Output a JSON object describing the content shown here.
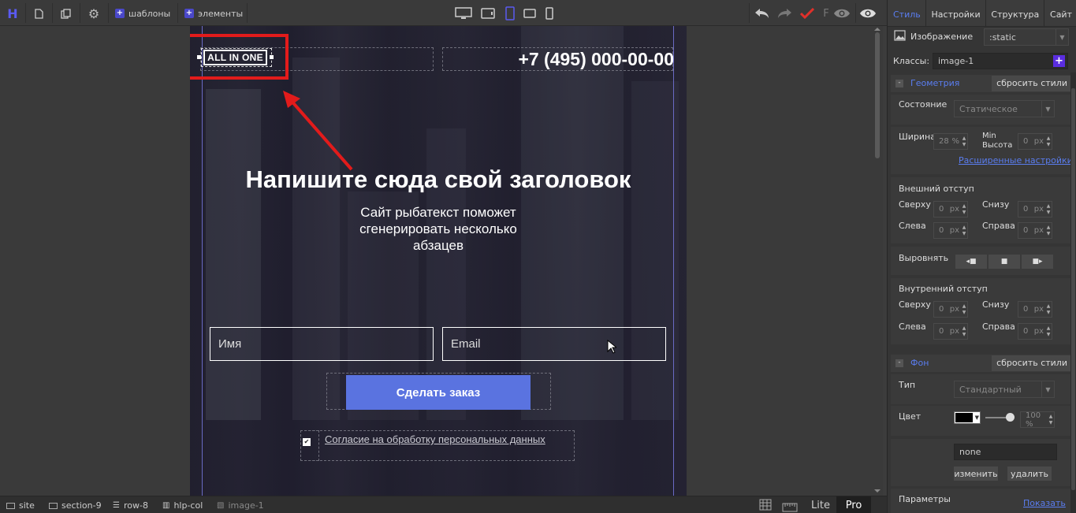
{
  "toolbar": {
    "logo": "H",
    "templates_label": "шаблоны",
    "elements_label": "элементы",
    "preview_letter": "F"
  },
  "site": {
    "logo_text": "ALL IN ONE",
    "phone": "+7 (495) 000-00-00",
    "headline": "Напишите сюда свой заголовок",
    "subtext": "Сайт рыбатекст поможет сгенерировать несколько абзацев",
    "name_placeholder": "Имя",
    "email_placeholder": "Email",
    "order_button": "Сделать заказ",
    "consent_text": "Согласие на обработку персональных данных",
    "consent_checked": true
  },
  "colors": {
    "accent": "#5a7df0",
    "annotation": "#e21b1b",
    "order_button": "#5a73e0",
    "save_check": "#e0302a"
  },
  "panel": {
    "tabs": [
      "Стиль",
      "Настройки",
      "Структура",
      "Сайт"
    ],
    "active_tab": "Стиль",
    "element_label": "Изображение",
    "position_value": ":static",
    "classes_label": "Классы:",
    "class_value": "image-1",
    "geometry": {
      "title": "Геометрия",
      "reset": "сбросить стили",
      "state_label": "Состояние",
      "state_value": "Статическое",
      "width_label": "Ширина",
      "width_value": "28",
      "width_unit": "%",
      "min_height_label": "Min Высота",
      "min_height_value": "0",
      "min_height_unit": "px",
      "advanced_link": "Расширенные настройки"
    },
    "margin": {
      "title": "Внешний отступ",
      "top_label": "Сверху",
      "top": "0",
      "bottom_label": "Снизу",
      "bottom": "0",
      "left_label": "Слева",
      "left": "0",
      "right_label": "Справа",
      "right": "0",
      "unit": "px"
    },
    "align_label": "Выровнять",
    "padding": {
      "title": "Внутренний отступ",
      "top_label": "Сверху",
      "top": "0",
      "bottom_label": "Снизу",
      "bottom": "0",
      "left_label": "Слева",
      "left": "0",
      "right_label": "Справа",
      "right": "0",
      "unit": "px"
    },
    "background": {
      "title": "Фон",
      "reset": "сбросить стили",
      "type_label": "Тип",
      "type_value": "Стандартный",
      "color_label": "Цвет",
      "opacity": "100 %",
      "image_value": "none",
      "change_button": "изменить",
      "delete_button": "удалить"
    },
    "params_label": "Параметры",
    "show_link": "Показать"
  },
  "bottombar": {
    "breadcrumbs": [
      "site",
      "section-9",
      "row-8",
      "hlp-col",
      "image-1"
    ],
    "lite_label": "Lite",
    "pro_label": "Pro"
  }
}
